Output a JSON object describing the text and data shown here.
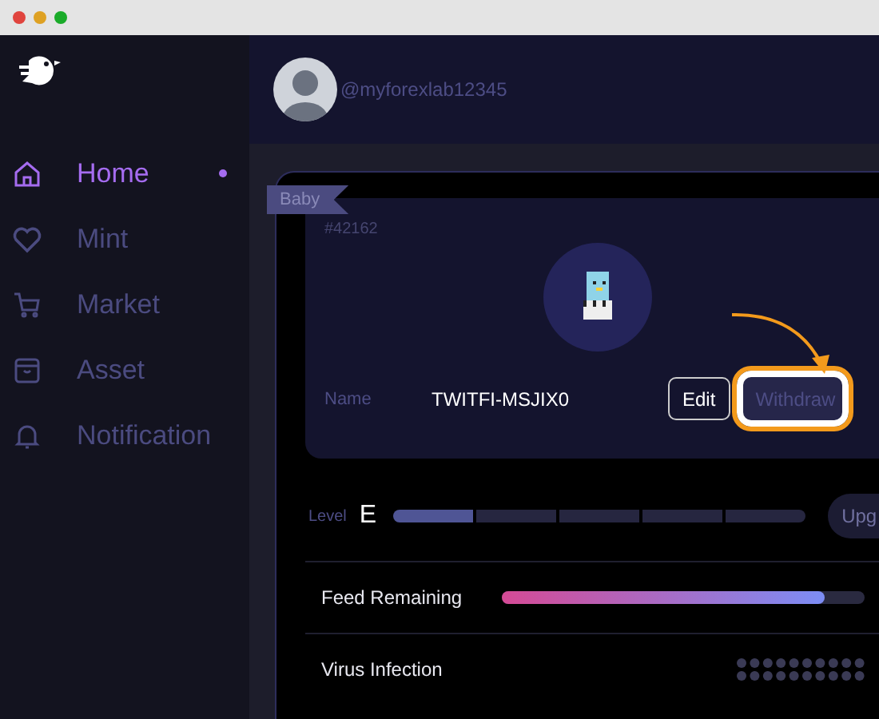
{
  "sidebar": {
    "items": [
      {
        "label": "Home",
        "selected": true
      },
      {
        "label": "Mint",
        "selected": false
      },
      {
        "label": "Market",
        "selected": false
      },
      {
        "label": "Asset",
        "selected": false
      },
      {
        "label": "Notification",
        "selected": false
      }
    ]
  },
  "header": {
    "username": "@myforexlab12345"
  },
  "card": {
    "badge": "Baby",
    "id": "#42162",
    "name_label": "Name",
    "name": "TWITFI-MSJIX0",
    "buttons": [
      {
        "label": "Edit",
        "highlighted": false
      },
      {
        "label": "Withdraw",
        "highlighted": true
      }
    ]
  },
  "level": {
    "label": "Level",
    "grade": "E",
    "level": 0.2,
    "button": "Upg"
  },
  "stats": [
    {
      "kind": "bar",
      "label": "Feed Remaining",
      "level": 0.89
    },
    {
      "kind": "dots",
      "label": "Virus Infection"
    }
  ]
}
